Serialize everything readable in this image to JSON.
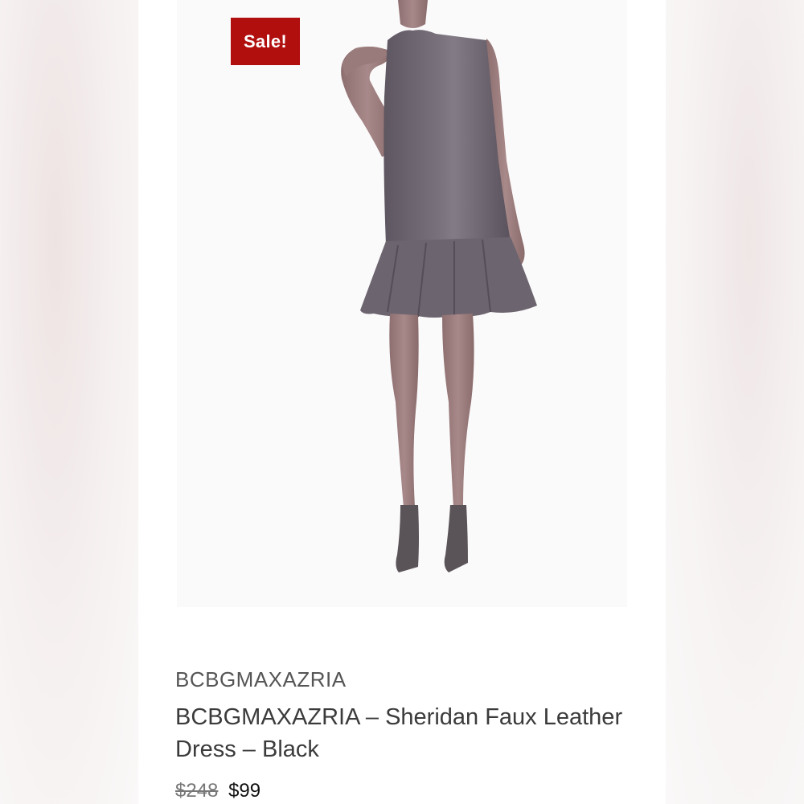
{
  "badge": {
    "label": "Sale!",
    "color": "#b10e0e"
  },
  "product": {
    "brand": "BCBGMAXAZRIA",
    "title": "BCBGMAXAZRIA – Sheridan Faux Leather Dress – Black",
    "price_original": "$248",
    "price_sale": "$99",
    "image": "model-in-sleeveless-faux-leather-dress-image"
  }
}
